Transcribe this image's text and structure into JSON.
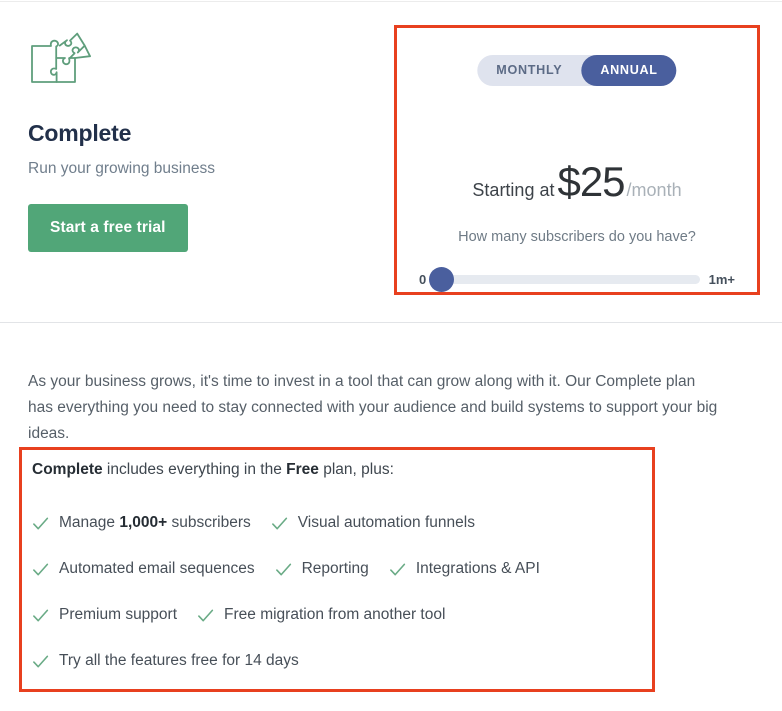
{
  "plan": {
    "icon": "puzzle-icon",
    "title": "Complete",
    "subtitle": "Run your growing business",
    "cta_label": "Start a free trial",
    "cta_color": "#51a678"
  },
  "pricing": {
    "accent_color": "#4a5f9e",
    "highlight_border": "#e8401f",
    "toggle": {
      "options": [
        {
          "label": "MONTHLY",
          "active": false
        },
        {
          "label": "ANNUAL",
          "active": true
        }
      ]
    },
    "price_prefix": "Starting at",
    "price_amount": "$25",
    "price_suffix": "/month",
    "slider": {
      "question": "How many subscribers do you have?",
      "min_label": "0",
      "max_label": "1m+",
      "value_percent": 0
    }
  },
  "description": "As your business grows, it's time to invest in a tool that can grow along with it. Our Complete plan has everything you need to stay connected with your audience and build systems to support your big ideas.",
  "features": {
    "heading_parts": {
      "plan_name": "Complete",
      "middle": " includes everything in the ",
      "compare_plan": "Free",
      "tail": " plan, plus:"
    },
    "check_color": "#6aab86",
    "rows": [
      [
        {
          "prefix": "Manage ",
          "strong": "1,000+",
          "suffix": " subscribers"
        },
        {
          "prefix": "Visual automation funnels",
          "strong": "",
          "suffix": ""
        }
      ],
      [
        {
          "prefix": "Automated email sequences",
          "strong": "",
          "suffix": ""
        },
        {
          "prefix": "Reporting",
          "strong": "",
          "suffix": ""
        },
        {
          "prefix": "Integrations & API",
          "strong": "",
          "suffix": ""
        }
      ],
      [
        {
          "prefix": "Premium support",
          "strong": "",
          "suffix": ""
        },
        {
          "prefix": "Free migration from another tool",
          "strong": "",
          "suffix": ""
        }
      ],
      [
        {
          "prefix": "Try all the features free for 14 days",
          "strong": "",
          "suffix": ""
        }
      ]
    ]
  }
}
